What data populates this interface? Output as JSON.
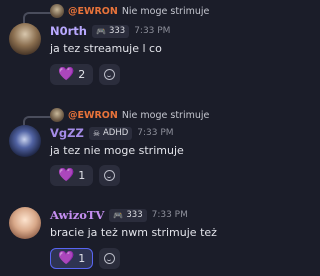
{
  "messages": [
    {
      "reply": {
        "author": "@EWRON",
        "text": "Nie moge strimuje"
      },
      "author": "N0rth",
      "tag": {
        "icon": "controller-icon",
        "label": "333"
      },
      "time": "7:33 PM",
      "text": "ja tez streamuje l co",
      "reaction": {
        "emoji": "💜",
        "count": "2",
        "active": false
      }
    },
    {
      "reply": {
        "author": "@EWRON",
        "text": "Nie moge strimuje"
      },
      "author": "VgZZ",
      "tag": {
        "icon": "skull-icon",
        "label": "ADHD"
      },
      "time": "7:33 PM",
      "text": "ja tez nie moge strimuje",
      "reaction": {
        "emoji": "💜",
        "count": "1",
        "active": false
      }
    },
    {
      "author": "AwizoTV",
      "tag": {
        "icon": "controller-icon",
        "label": "333"
      },
      "time": "7:33 PM",
      "text": "bracie ja też nwm strimuje też",
      "reaction": {
        "emoji": "💜",
        "count": "1",
        "active": true
      }
    }
  ]
}
